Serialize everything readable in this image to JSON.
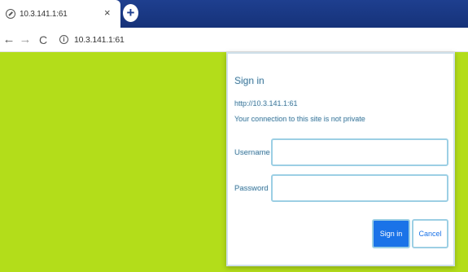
{
  "browser": {
    "tab": {
      "title": "10.3.141.1:61",
      "close_label": "×",
      "favicon": "globe-icon"
    },
    "new_tab_label": "+",
    "toolbar": {
      "back_label": "←",
      "forward_label": "→",
      "reload_label": "C",
      "info_icon_label": "i",
      "url": "10.3.141.1:61"
    },
    "colors": {
      "tabstrip": "#1e3f8f",
      "page_background": "#b3dd1a",
      "dialog_text": "#4a7b9b",
      "primary_button": "#1a73e8"
    }
  },
  "dialog": {
    "title": "Sign in",
    "url": "http://10.3.141.1:61",
    "warning": "Your connection to this site is not private",
    "username_label": "Username",
    "username_value": "",
    "password_label": "Password",
    "password_value": "",
    "signin_label": "Sign in",
    "cancel_label": "Cancel"
  }
}
